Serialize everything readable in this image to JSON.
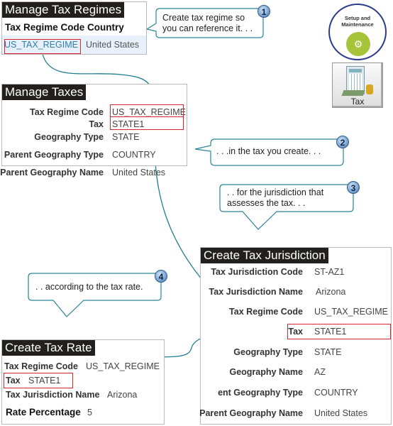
{
  "panels": {
    "regimes": {
      "title": "Manage Tax Regimes",
      "headers": [
        "Tax Regime Code",
        "Country"
      ],
      "row": {
        "code": "US_TAX_REGIME",
        "country": "United States"
      }
    },
    "taxes": {
      "title": "Manage Taxes",
      "fields": [
        {
          "label": "Tax Regime Code",
          "value": "US_TAX_REGIME"
        },
        {
          "label": "Tax",
          "value": "STATE1"
        },
        {
          "label": "Geography Type",
          "value": "STATE"
        },
        {
          "label": "Parent Geography Type",
          "value": "COUNTRY"
        },
        {
          "label": "Parent Geography Name",
          "value": "United States"
        }
      ]
    },
    "jurisdiction": {
      "title": "Create Tax Jurisdiction",
      "fields": [
        {
          "label": "Tax Jurisdiction Code",
          "value": "ST-AZ1"
        },
        {
          "label": "Tax Jurisdiction Name",
          "value": "Arizona"
        },
        {
          "label": "Tax Regime Code",
          "value": "US_TAX_REGIME"
        },
        {
          "label": "Tax",
          "value": "STATE1"
        },
        {
          "label": "Geography Type",
          "value": "STATE"
        },
        {
          "label": "Geography Name",
          "value": "AZ"
        },
        {
          "label": "ent Geography Type",
          "value": "COUNTRY"
        },
        {
          "label": "Parent Geography Name",
          "value": "United States"
        }
      ]
    },
    "rate": {
      "title": "Create Tax Rate",
      "fields": [
        {
          "label": "Tax Regime Code",
          "value": "US_TAX_REGIME"
        },
        {
          "label": "Tax",
          "value": "STATE1"
        },
        {
          "label": "Tax Jurisdiction Name",
          "value": "Arizona"
        },
        {
          "label": "Rate Percentage",
          "value": "5"
        }
      ]
    }
  },
  "callouts": [
    {
      "number": "1",
      "line1": "Create tax regime so",
      "line2": "you can reference it. . ."
    },
    {
      "number": "2",
      "line1": ". . .in the tax you create. . .",
      "line2": ""
    },
    {
      "number": "3",
      "line1": ". .  for the jurisdiction that",
      "line2": "assesses the tax. . ."
    },
    {
      "number": "4",
      "line1": ". .  according to the tax rate.",
      "line2": ""
    }
  ],
  "icons": {
    "setup": {
      "line1": "Setup and",
      "line2": "Maintenance"
    },
    "tax": {
      "label": "Tax"
    }
  },
  "colors": {
    "accent_teal": "#1f7f8f",
    "highlight_red": "#d9262e",
    "title_bg": "#231f1c",
    "link_blue": "#2f7ea8",
    "gear_green": "#a6c33a"
  }
}
